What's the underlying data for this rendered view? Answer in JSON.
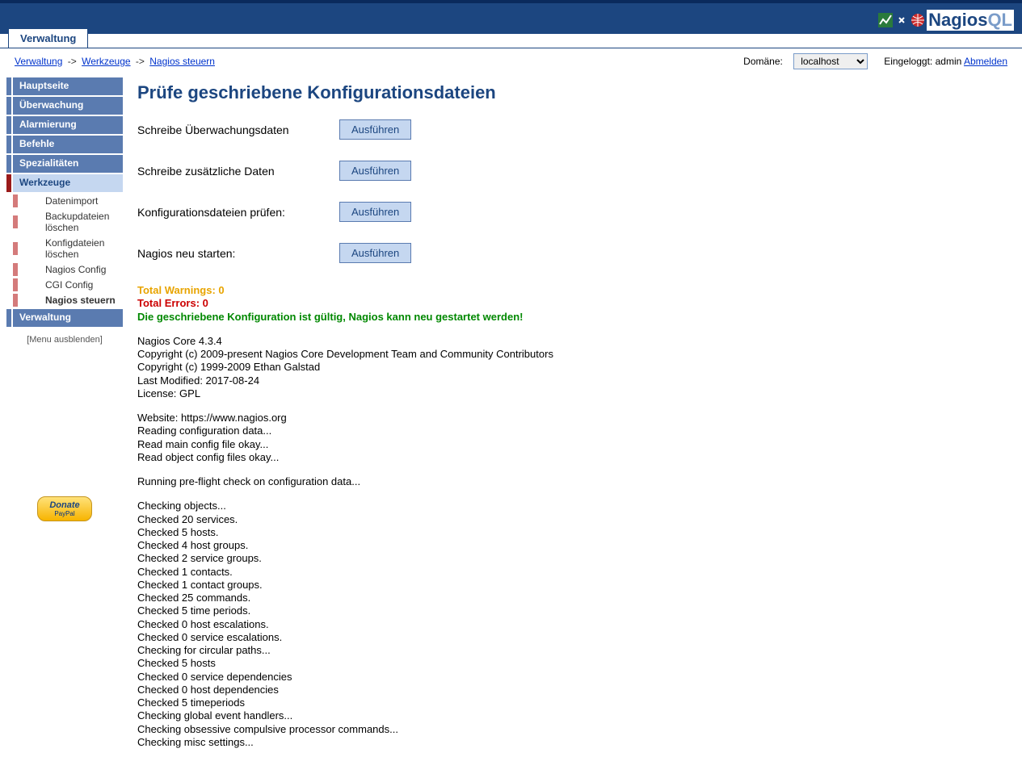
{
  "header": {
    "logo_part1": "Nagios",
    "logo_part2": "QL",
    "tab_label": "Verwaltung"
  },
  "infobar": {
    "breadcrumb": [
      {
        "label": "Verwaltung",
        "link": true
      },
      {
        "label": "Werkzeuge",
        "link": true
      },
      {
        "label": "Nagios steuern",
        "link": true
      }
    ],
    "domain_label": "Domäne:",
    "domain_value": "localhost",
    "logged_label": "Eingeloggt:",
    "user": "admin",
    "logout": "Abmelden"
  },
  "sidebar": {
    "items": [
      {
        "label": "Hauptseite",
        "type": "primary"
      },
      {
        "label": "Überwachung",
        "type": "primary"
      },
      {
        "label": "Alarmierung",
        "type": "primary"
      },
      {
        "label": "Befehle",
        "type": "primary"
      },
      {
        "label": "Spezialitäten",
        "type": "primary"
      },
      {
        "label": "Werkzeuge",
        "type": "active",
        "subs": [
          {
            "label": "Datenimport"
          },
          {
            "label": "Backupdateien löschen"
          },
          {
            "label": "Konfigdateien löschen"
          },
          {
            "label": "Nagios Config"
          },
          {
            "label": "CGI Config"
          },
          {
            "label": "Nagios steuern",
            "active": true
          }
        ]
      },
      {
        "label": "Verwaltung",
        "type": "primary"
      }
    ],
    "toggle": "[Menu ausblenden]",
    "donate": "Donate",
    "donate_sub": "PayPal"
  },
  "content": {
    "title": "Prüfe geschriebene Konfigurationsdateien",
    "actions": [
      {
        "label": "Schreibe Überwachungsdaten",
        "button": "Ausführen"
      },
      {
        "label": "Schreibe zusätzliche Daten",
        "button": "Ausführen"
      },
      {
        "label": "Konfigurationsdateien prüfen:",
        "button": "Ausführen"
      },
      {
        "label": "Nagios neu starten:",
        "button": "Ausführen"
      }
    ],
    "warnings": "Total Warnings: 0",
    "errors": "Total Errors: 0",
    "ok_msg": "Die geschriebene Konfiguration ist gültig, Nagios kann neu gestartet werden!",
    "version_block": [
      "Nagios Core 4.3.4",
      "Copyright (c) 2009-present Nagios Core Development Team and Community Contributors",
      "Copyright (c) 1999-2009 Ethan Galstad",
      "Last Modified: 2017-08-24",
      "License: GPL"
    ],
    "web_block": [
      "Website: https://www.nagios.org",
      "Reading configuration data...",
      "Read main config file okay...",
      "Read object config files okay..."
    ],
    "preflight": "Running pre-flight check on configuration data...",
    "check_block": [
      "Checking objects...",
      "Checked 20 services.",
      "Checked 5 hosts.",
      "Checked 4 host groups.",
      "Checked 2 service groups.",
      "Checked 1 contacts.",
      "Checked 1 contact groups.",
      "Checked 25 commands.",
      "Checked 5 time periods.",
      "Checked 0 host escalations.",
      "Checked 0 service escalations.",
      "Checking for circular paths...",
      "Checked 5 hosts",
      "Checked 0 service dependencies",
      "Checked 0 host dependencies",
      "Checked 5 timeperiods",
      "Checking global event handlers...",
      "Checking obsessive compulsive processor commands...",
      "Checking misc settings..."
    ]
  }
}
